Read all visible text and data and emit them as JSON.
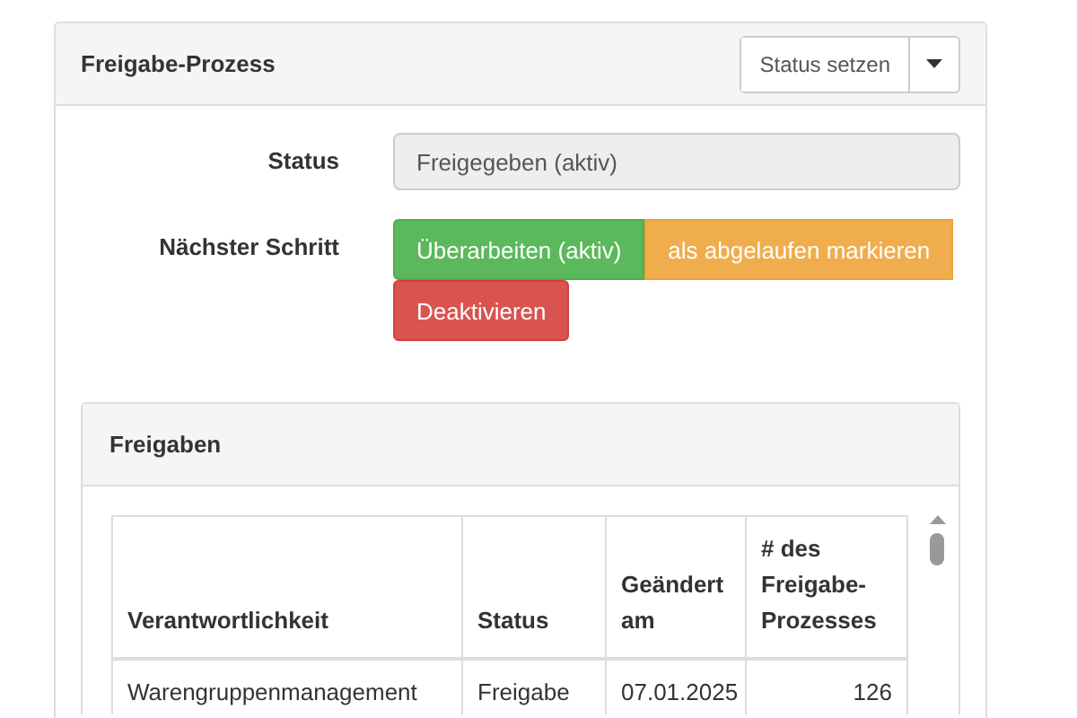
{
  "panel": {
    "title": "Freigabe-Prozess",
    "action_button": "Status setzen"
  },
  "status": {
    "label": "Status",
    "value": "Freigegeben (aktiv)"
  },
  "next_step": {
    "label": "Nächster Schritt",
    "buttons": [
      {
        "label": "Überarbeiten (aktiv)",
        "kind": "success"
      },
      {
        "label": "als abgelaufen markieren",
        "kind": "warning"
      },
      {
        "label": "Deaktivieren",
        "kind": "danger"
      }
    ]
  },
  "approvals": {
    "title": "Freigaben",
    "table": {
      "columns": [
        "Verantwortlichkeit",
        "Status",
        "Geändert am",
        "# des Freigabe-Prozesses"
      ],
      "rows": [
        [
          "Warengruppenmanagement",
          "Freigabe",
          "07.01.2025",
          "126"
        ]
      ]
    }
  }
}
